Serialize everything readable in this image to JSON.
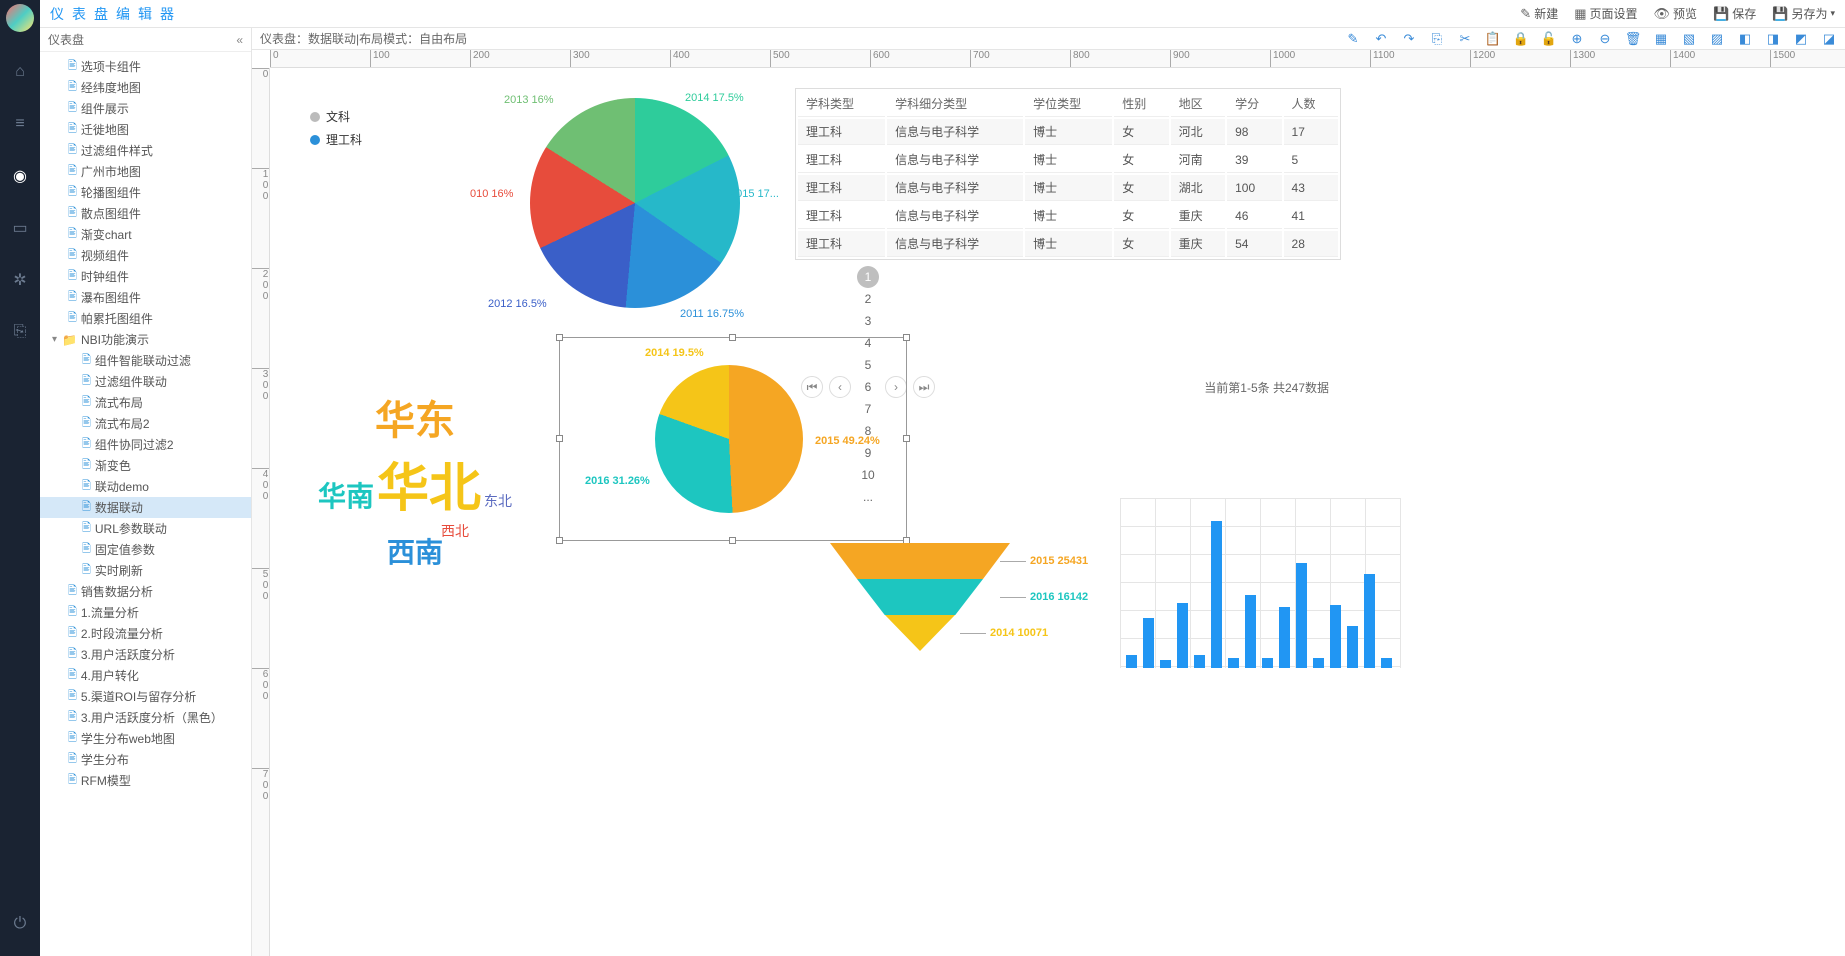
{
  "app": {
    "title": "仪表盘编辑器"
  },
  "topActions": {
    "new": "新建",
    "pageSetup": "页面设置",
    "preview": "预览",
    "save": "保存",
    "saveAs": "另存为"
  },
  "treeHead": "仪表盘",
  "tree": {
    "items1": [
      "选项卡组件",
      "经纬度地图",
      "组件展示",
      "迁徙地图",
      "过滤组件样式",
      "广州市地图",
      "轮播图组件",
      "散点图组件",
      "渐变chart",
      "视频组件",
      "时钟组件",
      "瀑布图组件",
      "帕累托图组件"
    ],
    "folder": "NBI功能演示",
    "items2": [
      "组件智能联动过滤",
      "过滤组件联动",
      "流式布局",
      "流式布局2",
      "组件协同过滤2",
      "渐变色",
      "联动demo",
      "数据联动",
      "URL参数联动",
      "固定值参数",
      "实时刷新"
    ],
    "selectedIndex": 7,
    "items3": [
      "销售数据分析",
      "1.流量分析",
      "2.时段流量分析",
      "3.用户活跃度分析",
      "4.用户转化",
      "5.渠道ROI与留存分析",
      "3.用户活跃度分析（黑色）",
      "学生分布web地图",
      "学生分布",
      "RFM模型"
    ]
  },
  "canvasInfo": {
    "prefix": "仪表盘：",
    "name": "数据联动",
    "sep": " | ",
    "modeLabel": "布局模式：",
    "mode": "自由布局"
  },
  "rulerH": [
    0,
    100,
    200,
    300,
    400,
    500,
    600,
    700,
    800,
    900,
    1000,
    1100,
    1200,
    1300,
    1400,
    1500
  ],
  "rulerV": [
    0,
    100,
    200,
    300,
    400,
    500,
    600,
    700
  ],
  "legend": {
    "a": "文科",
    "b": "理工科"
  },
  "chart_data": [
    {
      "type": "pie",
      "id": "pie1",
      "series": [
        {
          "name": "2014",
          "value": 17.5,
          "color": "#2ecc9b"
        },
        {
          "name": "2015",
          "value": 17.17,
          "color": "#26b8c9"
        },
        {
          "name": "2011",
          "value": 16.75,
          "color": "#2b90d9"
        },
        {
          "name": "2012",
          "value": 16.5,
          "color": "#3a5fc8"
        },
        {
          "name": "2010",
          "value": 16,
          "color": "#e74c3c"
        },
        {
          "name": "2013",
          "value": 16,
          "color": "#6fbf73"
        }
      ],
      "labels": {
        "l0": "2014 17.5%",
        "l1": "2015 17...",
        "l2": "2011 16.75%",
        "l3": "2012 16.5%",
        "l4": "010 16%",
        "l5": "2013 16%"
      }
    },
    {
      "type": "pie",
      "id": "pie2",
      "series": [
        {
          "name": "2015",
          "value": 49.24,
          "color": "#f5a623"
        },
        {
          "name": "2016",
          "value": 31.26,
          "color": "#1dc6c0"
        },
        {
          "name": "2014",
          "value": 19.5,
          "color": "#f5c518"
        }
      ],
      "labels": {
        "l0": "2015 49.24%",
        "l1": "2016 31.26%",
        "l2": "2014 19.5%"
      }
    },
    {
      "type": "bar",
      "id": "bars",
      "values": [
        12,
        48,
        8,
        62,
        12,
        140,
        10,
        70,
        10,
        58,
        100,
        10,
        60,
        40,
        90,
        10
      ],
      "ylim": [
        0,
        160
      ]
    },
    {
      "type": "funnel",
      "id": "funnel",
      "series": [
        {
          "name": "2015",
          "value": 25431,
          "color": "#f5a623"
        },
        {
          "name": "2016",
          "value": 16142,
          "color": "#1dc6c0"
        },
        {
          "name": "2014",
          "value": 10071,
          "color": "#f5c518"
        }
      ],
      "labels": {
        "l0": "2015 25431",
        "l1": "2016 16142",
        "l2": "2014 10071"
      }
    }
  ],
  "wordcloud": {
    "huadong": "华东",
    "huanan": "华南",
    "huabei": "华北",
    "dongbei": "东北",
    "xinan": "西南",
    "xibei": "西北"
  },
  "table": {
    "headers": [
      "学科类型",
      "学科细分类型",
      "学位类型",
      "性别",
      "地区",
      "学分",
      "人数"
    ],
    "rows": [
      [
        "理工科",
        "信息与电子科学",
        "博士",
        "女",
        "河北",
        "98",
        "17"
      ],
      [
        "理工科",
        "信息与电子科学",
        "博士",
        "女",
        "河南",
        "39",
        "5"
      ],
      [
        "理工科",
        "信息与电子科学",
        "博士",
        "女",
        "湖北",
        "100",
        "43"
      ],
      [
        "理工科",
        "信息与电子科学",
        "博士",
        "女",
        "重庆",
        "46",
        "41"
      ],
      [
        "理工科",
        "信息与电子科学",
        "博士",
        "女",
        "重庆",
        "54",
        "28"
      ]
    ],
    "pages": [
      "1",
      "2",
      "3",
      "4",
      "5",
      "6",
      "7",
      "8",
      "9",
      "10",
      "..."
    ],
    "info": "当前第1-5条 共247数据"
  }
}
